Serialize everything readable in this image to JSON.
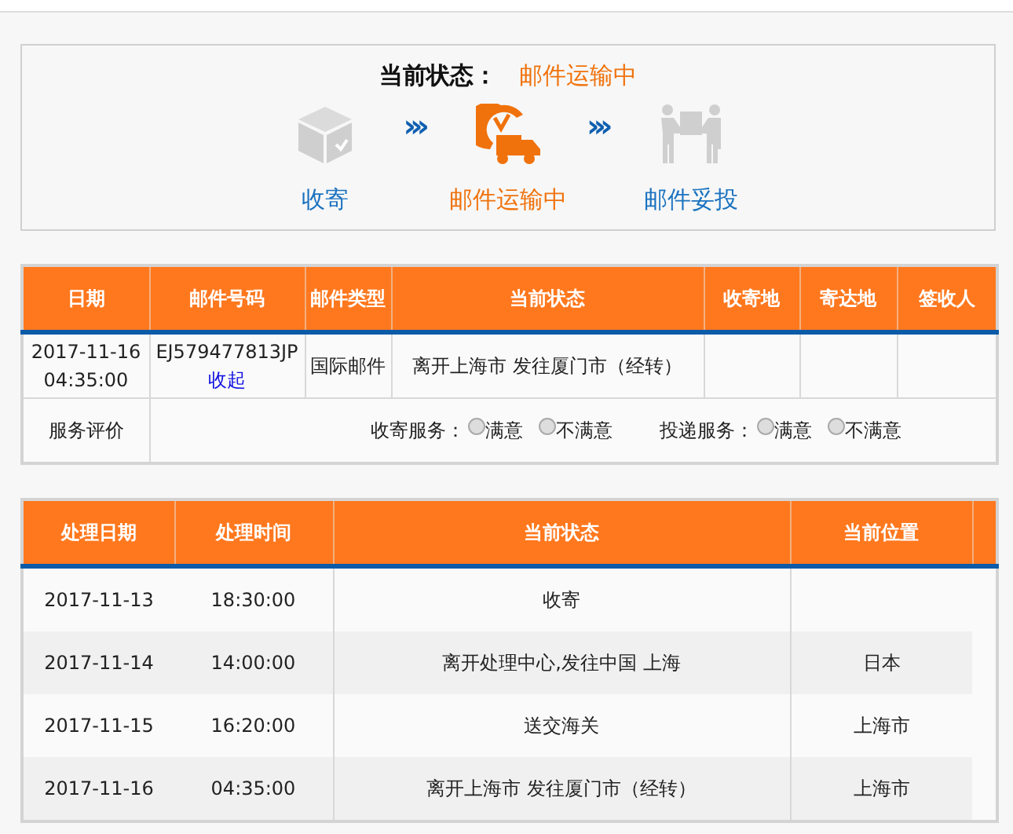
{
  "status": {
    "label": "当前状态：",
    "value": "邮件运输中"
  },
  "steps": [
    {
      "kind": "box",
      "label": "收寄",
      "selected": false
    },
    {
      "kind": "truck",
      "label": "邮件运输中",
      "selected": true
    },
    {
      "kind": "handover",
      "label": "邮件妥投",
      "selected": false
    }
  ],
  "arrows": [
    "›››",
    "›››"
  ],
  "mail_table": {
    "columns": [
      "日期",
      "邮件号码",
      "邮件类型",
      "当前状态",
      "收寄地",
      "寄达地",
      "签收人"
    ],
    "row": {
      "date": "2017-11-16 04:35:00",
      "number": "EJ579477813JP",
      "collapse_link": "收起",
      "type": "国际邮件",
      "status": "离开上海市 发往厦门市（经转）"
    },
    "rating": {
      "label": "服务评价",
      "groups": [
        {
          "label": "收寄服务：",
          "options": [
            {
              "label": "满意",
              "checked": false
            },
            {
              "label": "不满意",
              "checked": false
            }
          ]
        },
        {
          "label": "投递服务：",
          "options": [
            {
              "label": "满意",
              "checked": false
            },
            {
              "label": "不满意",
              "checked": false
            }
          ]
        }
      ]
    }
  },
  "track_table": {
    "columns": [
      "处理日期",
      "处理时间",
      "当前状态",
      "当前位置"
    ],
    "rows": [
      {
        "date": "2017-11-13",
        "time": "18:30:00",
        "status": "收寄"
      },
      {
        "date": "2017-11-14",
        "time": "14:00:00",
        "status": "离开处理中心,发往中国 上海",
        "location": "日本"
      },
      {
        "date": "2017-11-15",
        "time": "16:20:00",
        "status": "送交海关",
        "location": "上海市"
      },
      {
        "date": "2017-11-16",
        "time": "04:35:00",
        "status": "离开上海市 发往厦门市（经转）",
        "location": "上海市"
      }
    ]
  }
}
